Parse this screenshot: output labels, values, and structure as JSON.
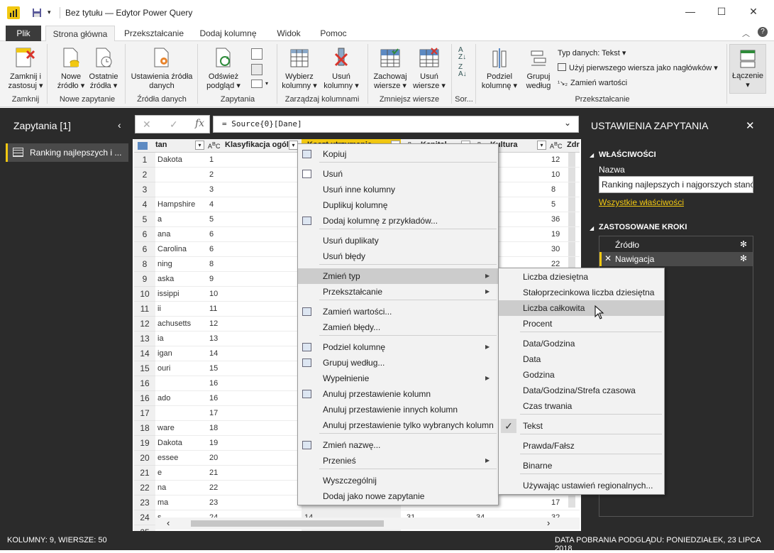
{
  "window": {
    "title": "Bez tytułu — Edytor Power Query"
  },
  "ribbon_tabs": [
    "Plik",
    "Strona główna",
    "Przekształcanie",
    "Dodaj kolumnę",
    "Widok",
    "Pomoc"
  ],
  "ribbon": {
    "zamknij": "Zamknij i zastosuj",
    "nowe_zrodlo": "Nowe źródło",
    "ostatnie_zrodla": "Ostatnie źródła",
    "ustawienia_zrodla": "Ustawienia źródła danych",
    "odswiez": "Odśwież podgląd",
    "wybierz_kolumny": "Wybierz kolumny",
    "usun_kolumny": "Usuń kolumny",
    "zachowaj": "Zachowaj wiersze",
    "usun_wiersze": "Usuń wiersze",
    "podziel": "Podziel kolumnę",
    "grupuj": "Grupuj według",
    "typ_danych": "Typ danych: Tekst",
    "pierwszy_wiersz": "Użyj pierwszego wiersza jako nagłówków",
    "zamien_wartosci": "Zamień wartości",
    "laczenie": "Łączenie",
    "groups": [
      "Zamknij",
      "Nowe zapytanie",
      "Źródła danych",
      "Zapytania",
      "Zarządzaj kolumnami",
      "Zmniejsz wiersze",
      "Sor...",
      "Przekształcanie"
    ]
  },
  "queries": {
    "header": "Zapytania [1]",
    "item": "Ranking najlepszych i ..."
  },
  "formula": "= Source{0}[Dane]",
  "grid": {
    "columns": [
      "tan",
      "Klasyfikacja ogóln",
      "Koszt utrzymania",
      "Kapital",
      "Kultura",
      "Zdr"
    ],
    "state": [
      "Dakota",
      "",
      "",
      "Hampshire",
      "a",
      "ana",
      "Carolina",
      "ning",
      "aska",
      "issippi",
      "ii",
      "achusetts",
      "ia",
      "igan",
      "ouri",
      "",
      "ado",
      "",
      "ware",
      "Dakota",
      "essee",
      "e",
      "na",
      "ma",
      "s"
    ],
    "rank": [
      "1",
      "2",
      "3",
      "4",
      "5",
      "6",
      "6",
      "8",
      "9",
      "10",
      "11",
      "12",
      "13",
      "14",
      "15",
      "16",
      "16",
      "17",
      "18",
      "19",
      "20",
      "21",
      "22",
      "23",
      "24",
      "25"
    ],
    "zdr": [
      "12",
      "10",
      "8",
      "5",
      "36",
      "19",
      "30",
      "22",
      "",
      "",
      "",
      "",
      "",
      "",
      "",
      "",
      "",
      "",
      "",
      "",
      "",
      "",
      "",
      "17",
      "32"
    ],
    "row_koszt_25": "14",
    "row_kapital_25": "31",
    "row_kultura_25": "34"
  },
  "context_menu": [
    "Kopiuj",
    "Usuń",
    "Usuń inne kolumny",
    "Duplikuj kolumnę",
    "Dodaj kolumnę z przykładów...",
    "Usuń duplikaty",
    "Usuń błędy",
    "Zmień typ",
    "Przekształcanie",
    "Zamień wartości...",
    "Zamień błędy...",
    "Podziel kolumnę",
    "Grupuj według...",
    "Wypełnienie",
    "Anuluj przestawienie kolumn",
    "Anuluj przestawienie innych kolumn",
    "Anuluj przestawienie tylko wybranych kolumn",
    "Zmień nazwę...",
    "Przenieś",
    "Wyszczególnij",
    "Dodaj jako nowe zapytanie"
  ],
  "submenu": [
    "Liczba dziesiętna",
    "Stałoprzecinkowa liczba dziesiętna",
    "Liczba całkowita",
    "Procent",
    "Data/Godzina",
    "Data",
    "Godzina",
    "Data/Godzina/Strefa czasowa",
    "Czas trwania",
    "Tekst",
    "Prawda/Fałsz",
    "Binarne",
    "Używając ustawień regionalnych..."
  ],
  "settings": {
    "title": "USTAWIENIA ZAPYTANIA",
    "props": "WŁAŚCIWOŚCI",
    "name_label": "Nazwa",
    "name_value": "Ranking najlepszych i najgorszych stanó",
    "all_props": "Wszystkie właściwości",
    "steps_header": "ZASTOSOWANE KROKI",
    "steps": [
      "Źródło",
      "Nawigacja"
    ]
  },
  "status": {
    "left": "KOLUMNY: 9, WIERSZE: 50",
    "right": "DATA POBRANIA PODGLĄDU: PONIEDZIAŁEK, 23 LIPCA 2018"
  },
  "colors": {
    "accent": "#f2c811",
    "dark": "#2b2b2b"
  }
}
